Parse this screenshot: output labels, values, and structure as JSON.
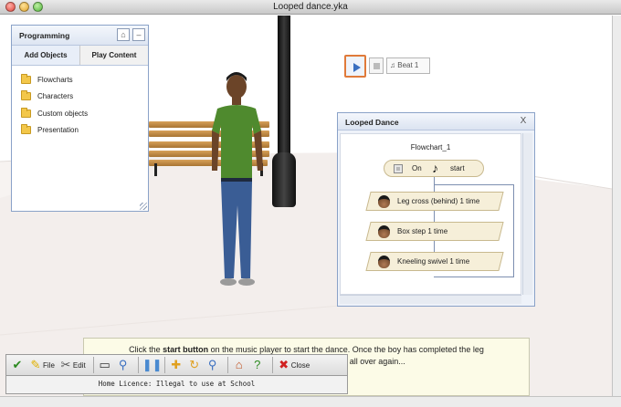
{
  "window": {
    "title": "Looped dance.yka"
  },
  "programming_panel": {
    "title": "Programming",
    "tabs": [
      {
        "label": "Add Objects",
        "active": true
      },
      {
        "label": "Play Content",
        "active": false
      }
    ],
    "items": [
      {
        "label": "Flowcharts",
        "icon": "folder-icon"
      },
      {
        "label": "Characters",
        "icon": "folder-icon"
      },
      {
        "label": "Custom objects",
        "icon": "folder-icon"
      },
      {
        "label": "Presentation",
        "icon": "folder-icon"
      }
    ],
    "header_icons": [
      "home-icon",
      "minimize-icon"
    ]
  },
  "music_player": {
    "beat_label": "Beat 1"
  },
  "dance_window": {
    "title": "Looped Dance",
    "close_label": "X",
    "flowchart_name": "Flowchart_1",
    "start_block": {
      "on_label": "On",
      "start_label": "start"
    },
    "steps": [
      {
        "label": "Leg cross (behind)   1   time"
      },
      {
        "label": "Box step   1   time"
      },
      {
        "label": "Kneeling swivel   1   time"
      }
    ]
  },
  "instructions": {
    "before": "Click the ",
    "bold": "start button",
    "after": " on the music player to start the dance. Once the boy has completed the leg",
    "line2": "round and he'll do it all over again..."
  },
  "toolbar": {
    "file_label": "File",
    "edit_label": "Edit",
    "close_label": "Close"
  },
  "licence": {
    "text": "Home Licence: Illegal to use at School"
  },
  "colors": {
    "panel_border": "#8aa2c8",
    "accent_orange": "#e07a3a",
    "flow_block": "#f6efd9",
    "instructions_bg": "#fcfbe7"
  }
}
